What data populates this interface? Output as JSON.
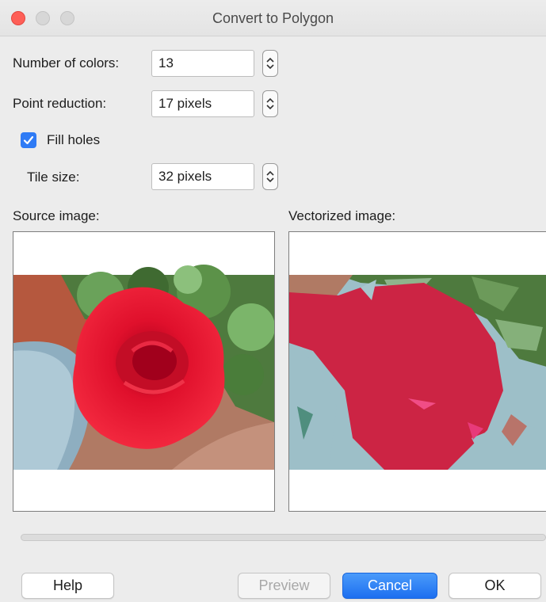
{
  "window": {
    "title": "Convert to Polygon"
  },
  "fields": {
    "number_of_colors": {
      "label": "Number of colors:",
      "value": "13"
    },
    "point_reduction": {
      "label": "Point reduction:",
      "value": "17 pixels"
    },
    "fill_holes": {
      "label": "Fill holes",
      "checked": true
    },
    "tile_size": {
      "label": "Tile size:",
      "value": "32 pixels"
    }
  },
  "previews": {
    "source_label": "Source image:",
    "vectorized_label": "Vectorized image:"
  },
  "buttons": {
    "help": "Help",
    "preview": "Preview",
    "cancel": "Cancel",
    "ok": "OK"
  },
  "colors": {
    "accent": "#2f7bf5",
    "rose_red": "#e0102c",
    "vector_red": "#cc2444",
    "leaf_green": "#4e7a3e",
    "pale_blue": "#9dbfc8"
  }
}
